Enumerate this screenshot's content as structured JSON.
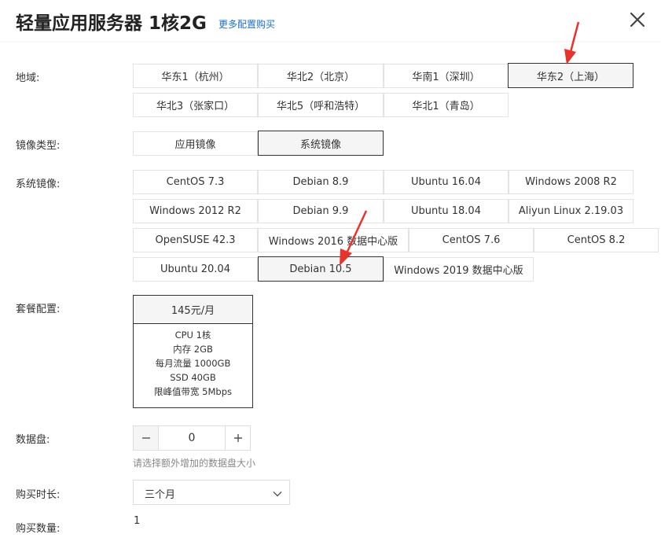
{
  "header": {
    "title": "轻量应用服务器 1核2G",
    "more_link": "更多配置购买",
    "close_icon": "close-icon"
  },
  "region": {
    "label": "地域:",
    "options": [
      "华东1（杭州）",
      "华北2（北京）",
      "华南1（深圳）",
      "华东2（上海）",
      "华北3（张家口）",
      "华北5（呼和浩特）",
      "华北1（青岛）"
    ],
    "selected": "华东2（上海）"
  },
  "image_type": {
    "label": "镜像类型:",
    "options": [
      "应用镜像",
      "系统镜像"
    ],
    "selected": "系统镜像"
  },
  "system_image": {
    "label": "系统镜像:",
    "options": [
      "CentOS 7.3",
      "Debian 8.9",
      "Ubuntu 16.04",
      "Windows 2008 R2",
      "Windows 2012 R2",
      "Debian 9.9",
      "Ubuntu 18.04",
      "Aliyun Linux 2.19.03",
      "OpenSUSE 42.3",
      "Windows 2016 数据中心版",
      "CentOS 7.6",
      "CentOS 8.2",
      "Ubuntu 20.04",
      "Debian 10.5",
      "Windows 2019 数据中心版"
    ],
    "selected": "Debian 10.5"
  },
  "plan": {
    "label": "套餐配置:",
    "price": "145元/月",
    "specs": [
      "CPU 1核",
      "内存 2GB",
      "每月流量 1000GB",
      "SSD 40GB",
      "限峰值带宽 5Mbps"
    ]
  },
  "data_disk": {
    "label": "数据盘:",
    "value": "0",
    "minus_icon": "minus-icon",
    "plus_icon": "plus-icon",
    "hint": "请选择额外增加的数据盘大小"
  },
  "duration": {
    "label": "购买时长:",
    "value": "三个月",
    "arrow_icon": "chevron-down-icon"
  },
  "quantity": {
    "label": "购买数量:",
    "value": "1"
  },
  "colors": {
    "accent_link": "#1a6fd1",
    "annotation_arrow": "#e8322c",
    "selected_border": "#333333"
  }
}
